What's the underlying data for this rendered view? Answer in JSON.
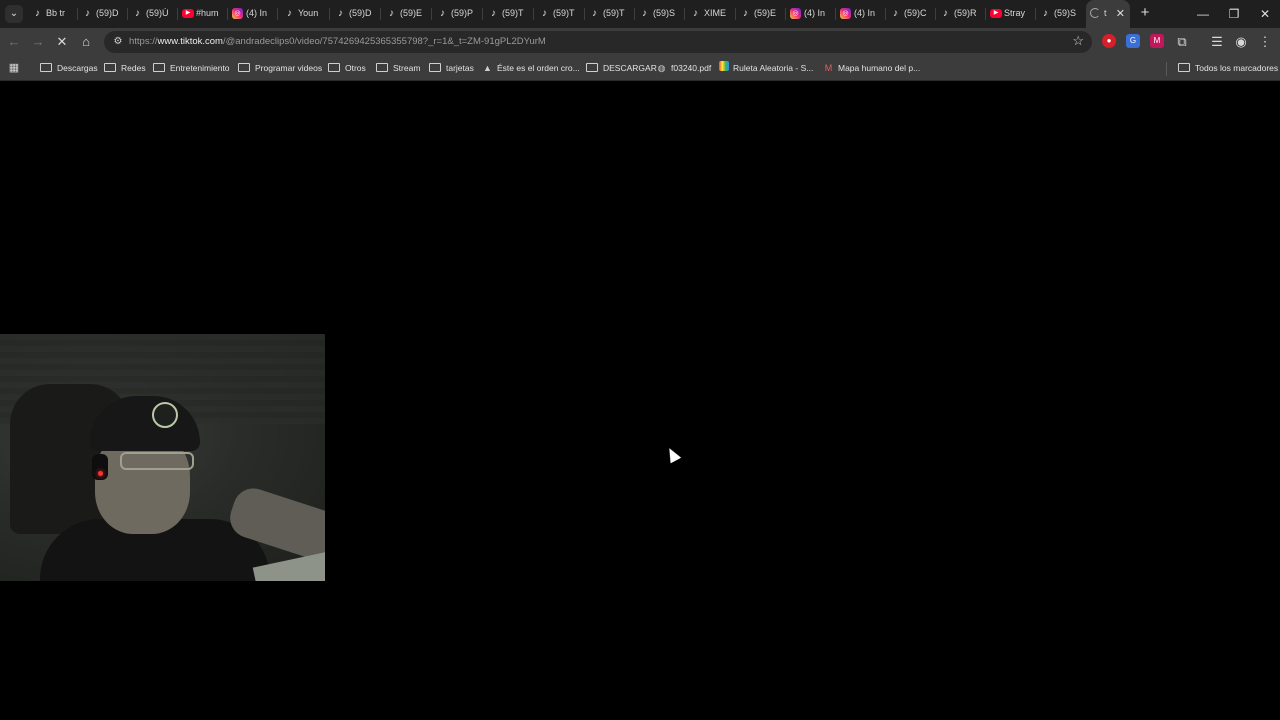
{
  "window": {
    "tabs": [
      {
        "label": "Bb tr",
        "icon": "tiktok"
      },
      {
        "label": "(59)D",
        "icon": "tiktok"
      },
      {
        "label": "(59)Ú",
        "icon": "tiktok"
      },
      {
        "label": "#hum",
        "icon": "youtube"
      },
      {
        "label": "(4) In",
        "icon": "instagram"
      },
      {
        "label": "Youn",
        "icon": "tiktok"
      },
      {
        "label": "(59)D",
        "icon": "tiktok"
      },
      {
        "label": "(59)E",
        "icon": "tiktok"
      },
      {
        "label": "(59)P",
        "icon": "tiktok"
      },
      {
        "label": "(59)T",
        "icon": "tiktok"
      },
      {
        "label": "(59)T",
        "icon": "tiktok"
      },
      {
        "label": "(59)T",
        "icon": "tiktok"
      },
      {
        "label": "(59)S",
        "icon": "tiktok"
      },
      {
        "label": "XIME",
        "icon": "tiktok"
      },
      {
        "label": "(59)E",
        "icon": "tiktok"
      },
      {
        "label": "(4) In",
        "icon": "instagram"
      },
      {
        "label": "(4) In",
        "icon": "instagram"
      },
      {
        "label": "(59)C",
        "icon": "tiktok"
      },
      {
        "label": "(59)R",
        "icon": "tiktok"
      },
      {
        "label": "Stray",
        "icon": "youtube"
      },
      {
        "label": "(59)S",
        "icon": "tiktok"
      },
      {
        "label": "t",
        "icon": "loading",
        "active": true
      }
    ],
    "controls": {
      "minimize": "—",
      "restore": "❐",
      "close": "✕"
    }
  },
  "toolbar": {
    "url_prefix": "https://",
    "url_host": "www.tiktok.com",
    "url_path": "/@andradeclips0/video/7574269425365355798?_r=1&_t=ZM-91gPL2DYurM"
  },
  "bookmarks": {
    "items": [
      {
        "label": "Descargas",
        "icon": "folder"
      },
      {
        "label": "Redes",
        "icon": "folder"
      },
      {
        "label": "Entretenimiento",
        "icon": "folder"
      },
      {
        "label": "Programar videos",
        "icon": "folder"
      },
      {
        "label": "Otros",
        "icon": "folder"
      },
      {
        "label": "Stream",
        "icon": "folder"
      },
      {
        "label": "tarjetas",
        "icon": "folder"
      },
      {
        "label": "Éste es el orden cro...",
        "icon": "page"
      },
      {
        "label": "DESCARGAR",
        "icon": "folder"
      },
      {
        "label": "f03240.pdf",
        "icon": "globe"
      },
      {
        "label": "Ruleta Aleatoria - S...",
        "icon": "wheel"
      },
      {
        "label": "Mapa humano del p...",
        "icon": "map"
      }
    ],
    "all_label": "Todos los marcadores"
  },
  "colors": {
    "page_background": "#000000",
    "chrome_frame": "#1f1f1f",
    "toolbar": "#3c3c3c"
  }
}
